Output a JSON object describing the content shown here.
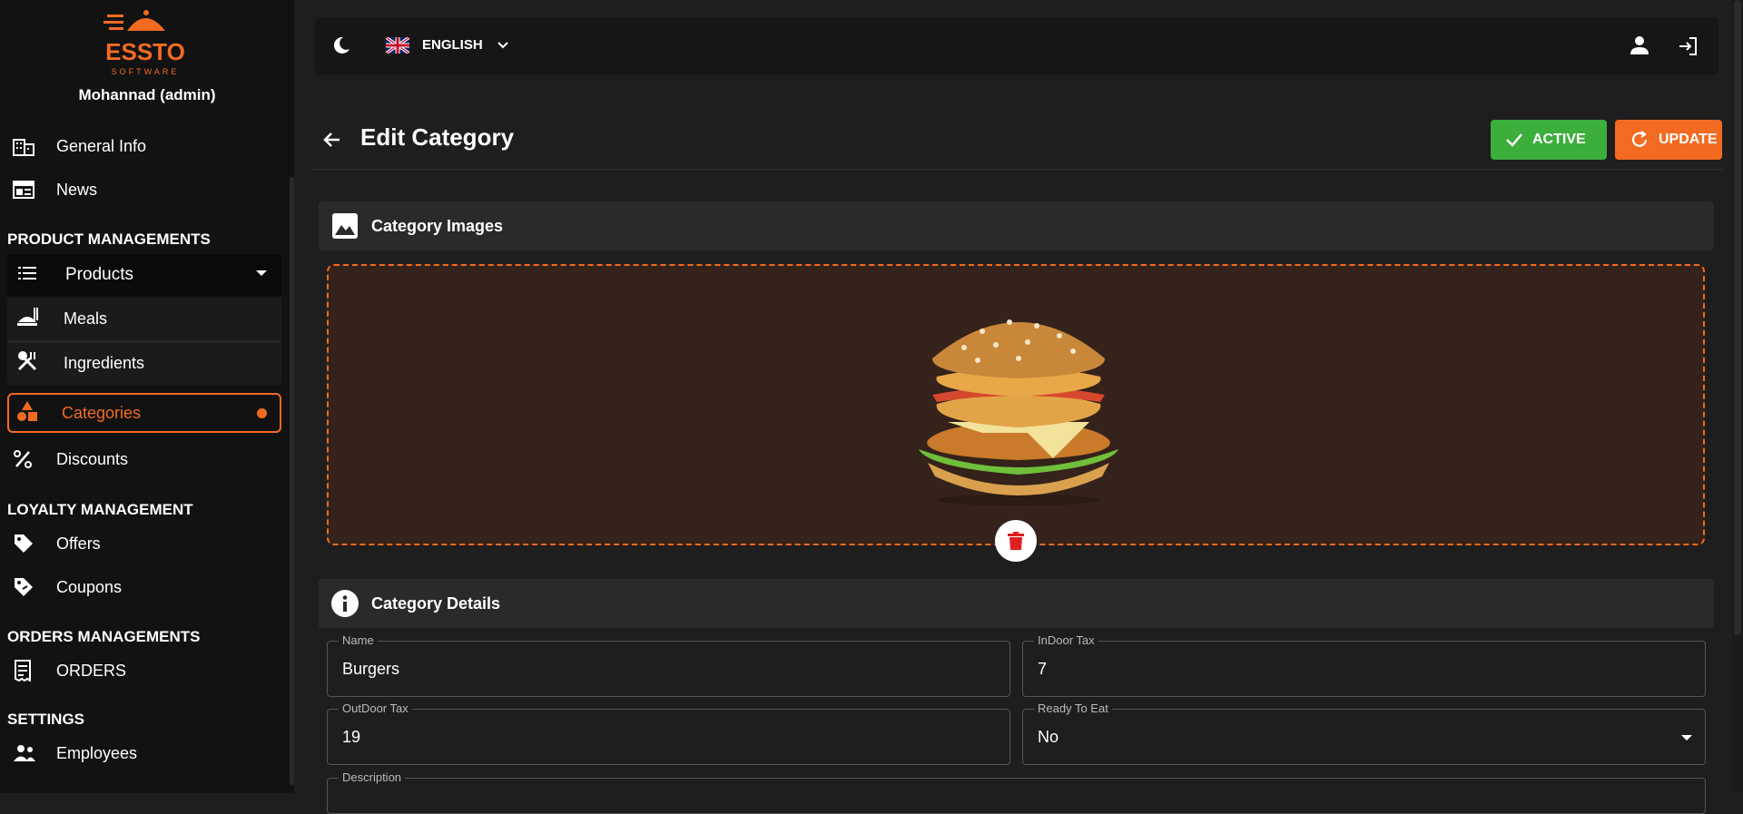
{
  "brand": {
    "logo_text": "ESSTO",
    "logo_subtext": "SOFTWARE",
    "accent": "#f26b21"
  },
  "user": {
    "name": "Mohannad (admin)"
  },
  "sidebar": {
    "general_info": "General Info",
    "news": "News",
    "section_products": "PRODUCT MANAGEMENTS",
    "products": "Products",
    "meals": "Meals",
    "ingredients": "Ingredients",
    "categories": "Categories",
    "discounts": "Discounts",
    "section_loyalty": "LOYALTY MANAGEMENT",
    "offers": "Offers",
    "coupons": "Coupons",
    "section_orders": "ORDERS MANAGEMENTS",
    "orders": "ORDERS",
    "section_settings": "SETTINGS",
    "employees": "Employees"
  },
  "topbar": {
    "language": "ENGLISH"
  },
  "header": {
    "title": "Edit Category",
    "active_label": "ACTIVE",
    "update_label": "UPDATE"
  },
  "images_card": {
    "title": "Category Images"
  },
  "details_card": {
    "title": "Category Details"
  },
  "form": {
    "name": {
      "label": "Name",
      "value": "Burgers"
    },
    "indoor_tax": {
      "label": "InDoor Tax",
      "value": "7"
    },
    "outdoor_tax": {
      "label": "OutDoor Tax",
      "value": "19"
    },
    "ready_to_eat": {
      "label": "Ready To Eat",
      "value": "No"
    },
    "description": {
      "label": "Description",
      "value": ""
    }
  }
}
